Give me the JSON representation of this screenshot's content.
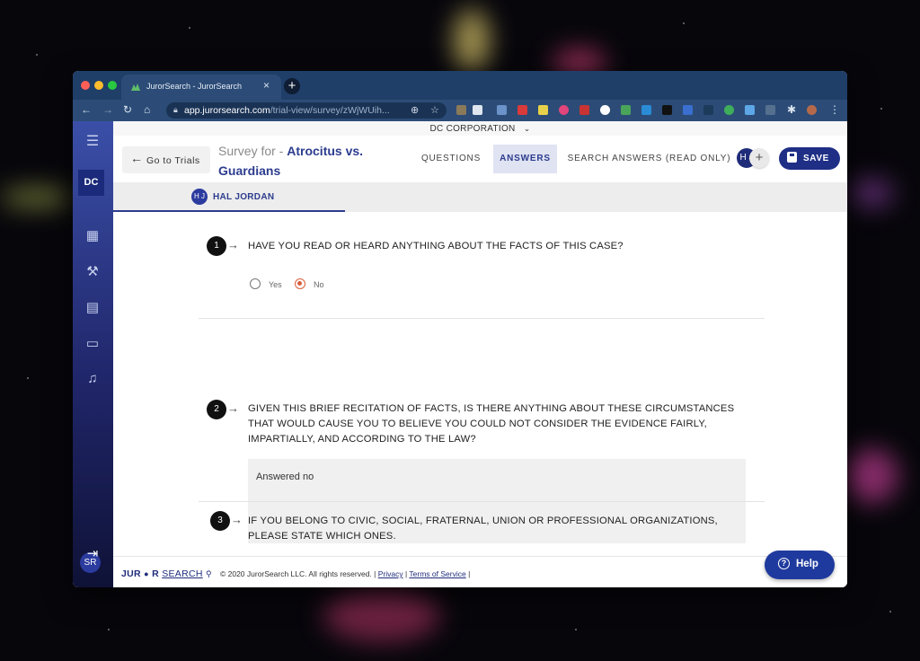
{
  "browser": {
    "tab_title": "JurorSearch - JurorSearch",
    "tab_close": "×",
    "new_tab": "+",
    "url_host": "app.jurorsearch.com",
    "url_path": "/trial-view/survey/zWjWUih...",
    "nav_icons": [
      "back-icon",
      "forward-icon",
      "reload-icon",
      "home-icon"
    ]
  },
  "app": {
    "org_name": "DC CORPORATION",
    "org_caret": "⌄",
    "sidebar": {
      "org_badge": "DC",
      "items": [
        "dashboard-icon",
        "gavel-icon",
        "building-icon",
        "chat-icon",
        "bell-icon"
      ],
      "user_badge": "SR",
      "logout": "⇥"
    },
    "header": {
      "go_to_trials": "Go to Trials",
      "survey_prefix": "Survey for - ",
      "case_name": "Atrocitus vs. Guardians",
      "tabs": [
        {
          "label": "QUESTIONS",
          "active": false
        },
        {
          "label": "ANSWERS",
          "active": true
        },
        {
          "label": "SEARCH ANSWERS (READ ONLY)",
          "active": false
        }
      ],
      "avatar": "H J",
      "add": "+",
      "save_label": "SAVE"
    },
    "juror": {
      "initials": "H J",
      "name": "HAL JORDAN"
    },
    "questions": [
      {
        "number": "1",
        "text": "HAVE YOU READ OR HEARD ANYTHING ABOUT THE FACTS OF THIS CASE?",
        "options": [
          {
            "label": "Yes",
            "selected": false
          },
          {
            "label": "No",
            "selected": true
          }
        ]
      },
      {
        "number": "2",
        "text": "GIVEN THIS BRIEF RECITATION OF FACTS, IS THERE ANYTHING ABOUT THESE CIRCUMSTANCES THAT WOULD CAUSE YOU TO BELIEVE YOU COULD NOT CONSIDER THE EVIDENCE FAIRLY, IMPARTIALLY, AND ACCORDING TO THE LAW?",
        "answer": "Answered no"
      },
      {
        "number": "3",
        "text": "IF YOU BELONG TO CIVIC, SOCIAL, FRATERNAL, UNION OR PROFESSIONAL ORGANIZATIONS, PLEASE STATE WHICH ONES."
      }
    ],
    "footer": {
      "logo_left": "JUR",
      "logo_mid": "R",
      "logo_search": "SEARCH",
      "copyright": "© 2020 JurorSearch LLC. All rights reserved. |",
      "privacy": "Privacy",
      "sep": "|",
      "terms": "Terms of Service",
      "sep_end": "|",
      "help_label": "Help"
    },
    "colors": {
      "primary": "#1f2f86",
      "accent_radio": "#d9603b",
      "browser_chrome": "#2c4c77"
    }
  }
}
